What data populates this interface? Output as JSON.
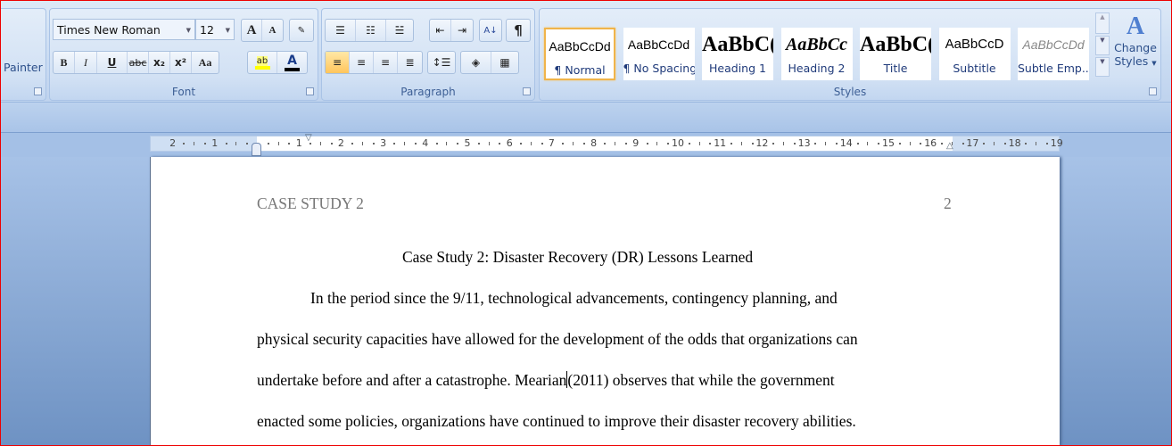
{
  "clipboard": {
    "painter_label": "Painter"
  },
  "font": {
    "group_label": "Font",
    "font_name": "Times New Roman",
    "font_size": "12",
    "buttons": [
      "B",
      "I",
      "U",
      "abc",
      "x₂",
      "x²",
      "Aa"
    ],
    "grow": "A",
    "shrink": "A",
    "highlight_color": "#ffff00",
    "font_color": "#000000"
  },
  "paragraph": {
    "group_label": "Paragraph",
    "pilcrow": "¶"
  },
  "styles": {
    "group_label": "Styles",
    "items": [
      {
        "preview": "AaBbCcDd",
        "name": "¶ Normal",
        "selected": true
      },
      {
        "preview": "AaBbCcDd",
        "name": "¶ No Spacing"
      },
      {
        "preview": "AaBbC(",
        "name": "Heading 1"
      },
      {
        "preview": "AaBbCc",
        "name": "Heading 2"
      },
      {
        "preview": "AaBbC(",
        "name": "Title"
      },
      {
        "preview": "AaBbCcD",
        "name": "Subtitle"
      },
      {
        "preview": "AaBbCcDd",
        "name": "Subtle Emp..."
      }
    ],
    "change_styles": [
      "Change",
      "Styles"
    ]
  },
  "ruler": {
    "left_labels": [
      "2",
      "1"
    ],
    "labels": [
      "1",
      "2",
      "3",
      "4",
      "5",
      "6",
      "7",
      "8",
      "9",
      "10",
      "11",
      "12",
      "13",
      "14",
      "15",
      "16",
      "17",
      "18",
      "19"
    ]
  },
  "document": {
    "header_left": "CASE STUDY 2",
    "header_right": "2",
    "title": "Case Study 2: Disaster Recovery (DR) Lessons Learned",
    "lines": [
      "In the period since the 9/11, technological advancements, contingency planning, and",
      "physical security capacities have allowed for the development of the odds that organizations can",
      "undertake before and after a catastrophe. Mearian",
      "enacted some policies, organizations have continued to improve their disaster recovery abilities."
    ],
    "line3_after_cursor": "(2011) observes that while the government"
  }
}
